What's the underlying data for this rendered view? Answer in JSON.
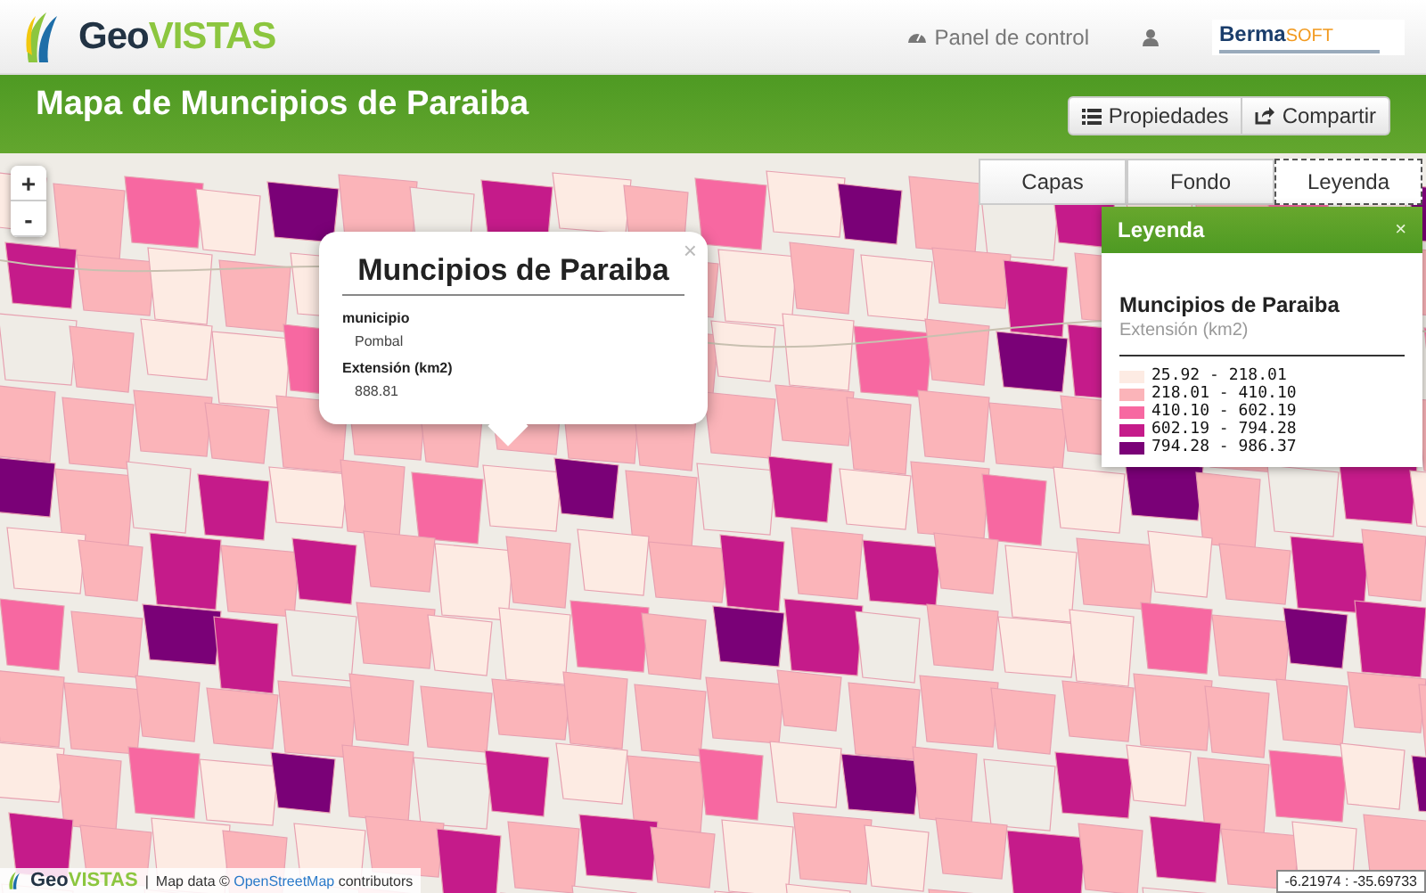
{
  "header": {
    "logo": {
      "part_1": "Geo",
      "part_2": "VISTAS"
    },
    "nav": [
      {
        "label": "Panel de control",
        "kind": "dashboard"
      },
      {
        "kind": "user"
      }
    ],
    "partner_logo": {
      "part_1": "Berma",
      "part_2": "SOFT"
    }
  },
  "title_bar": {
    "title": "Mapa de Muncipios de Paraiba",
    "buttons": [
      {
        "label": "Propiedades",
        "kind": "list"
      },
      {
        "label": "Compartir",
        "kind": "share"
      }
    ]
  },
  "map": {
    "zoom_controls": [
      "+",
      "-"
    ],
    "tabs": [
      {
        "label": "Capas",
        "selected": false
      },
      {
        "label": "Fondo",
        "selected": false
      },
      {
        "label": "Leyenda",
        "selected": true
      }
    ],
    "popup": {
      "close": "×",
      "title": "Muncipios de Paraiba",
      "fields": [
        {
          "label": "municipio",
          "value": "Pombal"
        },
        {
          "label": "Extensión (km2)",
          "value": "888.81"
        }
      ]
    },
    "legend": {
      "header": "Leyenda",
      "close": "×",
      "title": "Muncipios de Paraiba",
      "subtitle": "Extensión (km2)",
      "items": [
        {
          "label": "25.92 - 218.01",
          "color": "#fdebe3"
        },
        {
          "label": "218.01 - 410.10",
          "color": "#fbb4b9"
        },
        {
          "label": "410.10 - 602.19",
          "color": "#f768a1"
        },
        {
          "label": "602.19 - 794.28",
          "color": "#c51b8a"
        },
        {
          "label": "794.28 - 986.37",
          "color": "#7a0177"
        }
      ]
    },
    "attribution": {
      "logo_1": "Geo",
      "logo_2": "VISTAS",
      "separator": "|",
      "prefix": "Map data ©",
      "link": "OpenStreetMap",
      "suffix": "contributors"
    },
    "coordinates": "-6.21974 : -35.69733"
  }
}
